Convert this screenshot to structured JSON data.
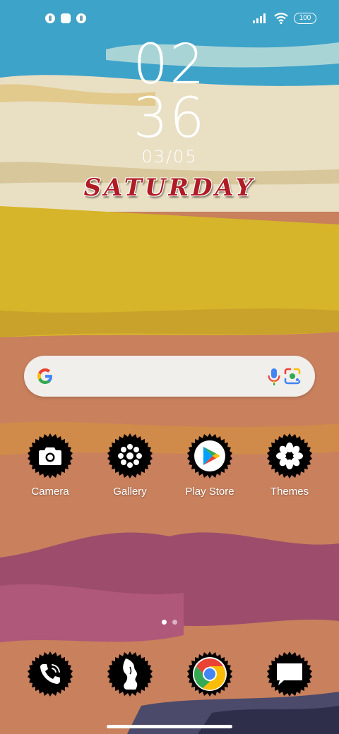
{
  "status_bar": {
    "left_icons": [
      "notification-icon",
      "square-notification-icon",
      "notification-icon"
    ],
    "battery": "100"
  },
  "clock": {
    "hours": "02",
    "minutes": "36",
    "date": "03/05",
    "weekday": "SATURDAY"
  },
  "search_bar": {
    "icons": [
      "google-g-icon",
      "microphone-icon",
      "google-lens-icon"
    ]
  },
  "apps": [
    {
      "label": "Camera",
      "icon": "camera-icon"
    },
    {
      "label": "Gallery",
      "icon": "gallery-flower-icon"
    },
    {
      "label": "Play Store",
      "icon": "play-store-icon"
    },
    {
      "label": "Themes",
      "icon": "themes-flower-icon"
    }
  ],
  "page_indicator": {
    "pages": 2,
    "current": 1
  },
  "dock": [
    {
      "icon": "phone-icon"
    },
    {
      "icon": "contacts-silhouette-icon"
    },
    {
      "icon": "chrome-icon"
    },
    {
      "icon": "messages-icon"
    }
  ],
  "colors": {
    "sky_blue": "#3ea3c9",
    "mustard": "#d6b52a",
    "terracotta": "#c8805d",
    "plum": "#9d4d6b",
    "weekday_red": "#b01c24"
  }
}
